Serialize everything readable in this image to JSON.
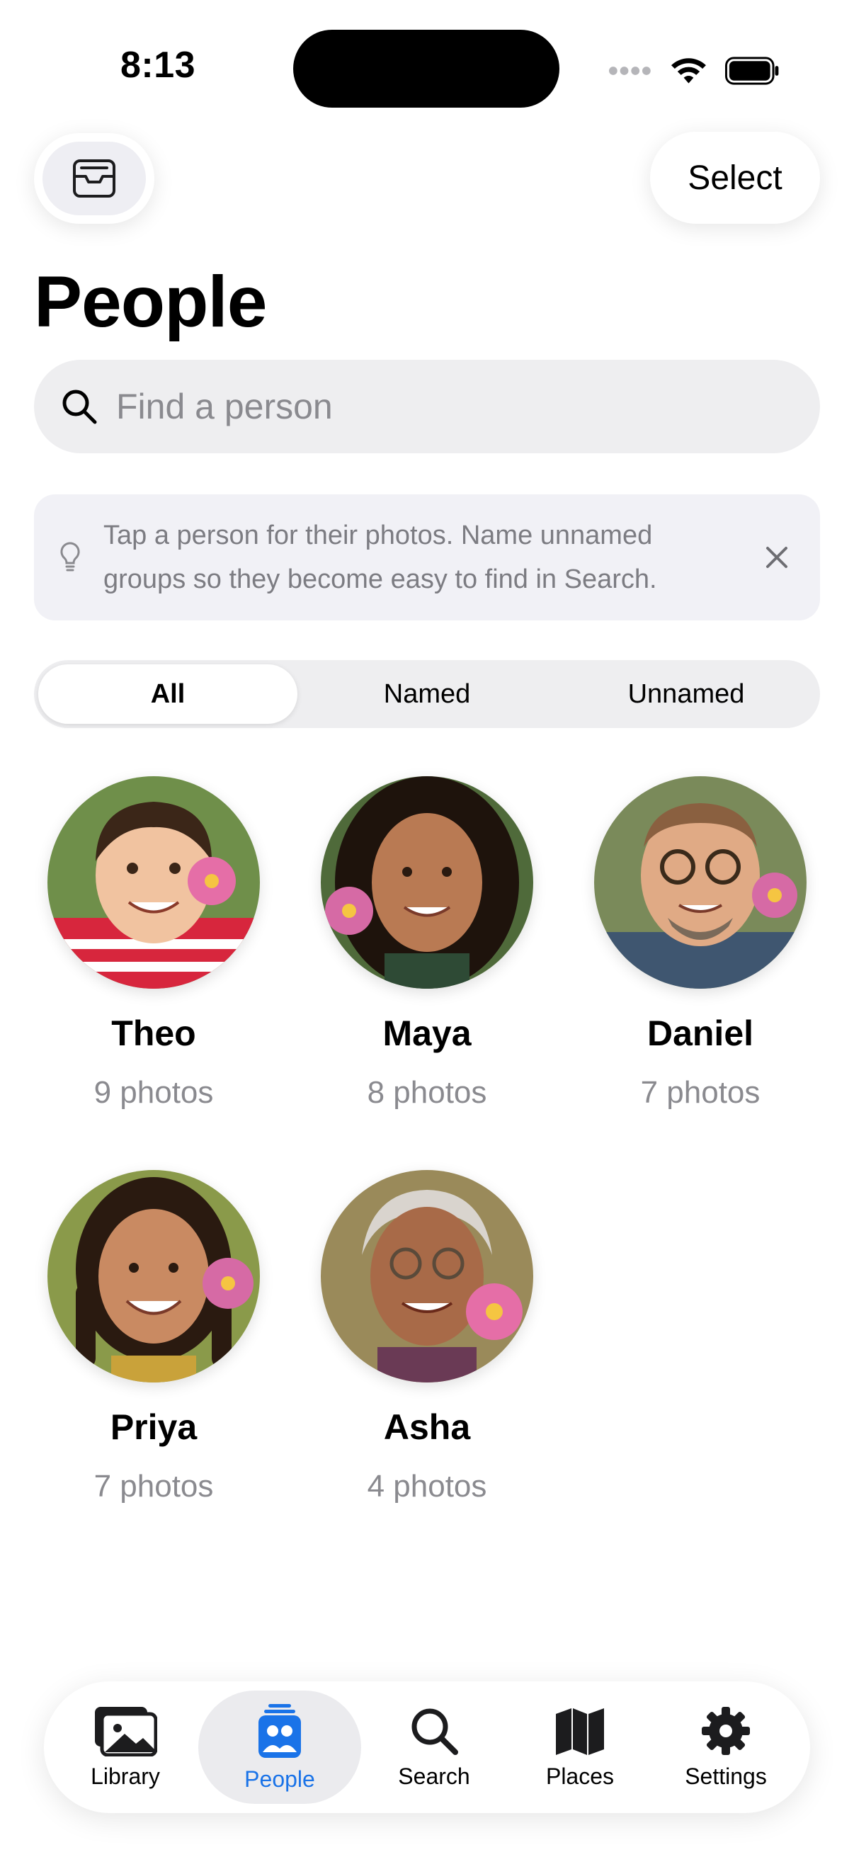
{
  "status_bar": {
    "time": "8:13"
  },
  "header": {
    "select_label": "Select",
    "title": "People"
  },
  "search": {
    "placeholder": "Find a person"
  },
  "tip": {
    "text": "Tap a person for their photos. Name unnamed groups so they become easy to find in Search."
  },
  "filter": {
    "options": [
      "All",
      "Named",
      "Unnamed"
    ],
    "selected": "All"
  },
  "people": [
    {
      "name": "Theo",
      "count": "9 photos"
    },
    {
      "name": "Maya",
      "count": "8 photos"
    },
    {
      "name": "Daniel",
      "count": "7 photos"
    },
    {
      "name": "Priya",
      "count": "7 photos"
    },
    {
      "name": "Asha",
      "count": "4 photos"
    }
  ],
  "tabbar": {
    "items": [
      {
        "label": "Library",
        "icon": "photo-stack-icon"
      },
      {
        "label": "People",
        "icon": "people-album-icon"
      },
      {
        "label": "Search",
        "icon": "search-icon"
      },
      {
        "label": "Places",
        "icon": "map-icon"
      },
      {
        "label": "Settings",
        "icon": "gear-icon"
      }
    ],
    "selected": "People",
    "accent": "#1a73e8"
  }
}
